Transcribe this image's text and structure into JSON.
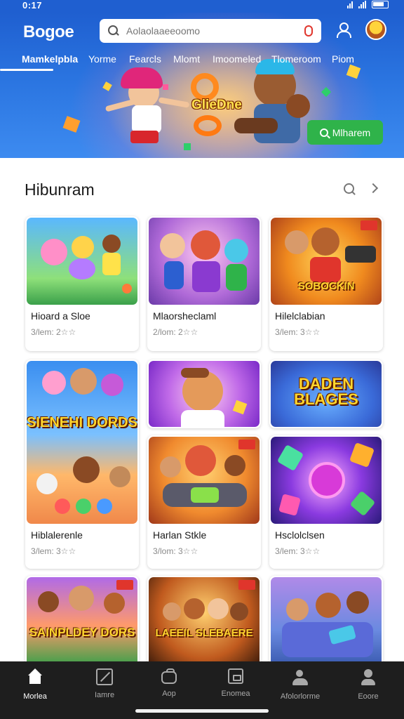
{
  "status_bar": {
    "time": "0:17"
  },
  "header": {
    "logo": "Bogoe",
    "search_placeholder": "Aolaolaaeeoomo",
    "nav_tabs": [
      "Mamkelpbla",
      "Yorme",
      "Fearcls",
      "Mlomt",
      "Imoomeled",
      "Tlomeroom",
      "Piom"
    ],
    "active_tab_index": 0
  },
  "hero": {
    "title": "GlieDne",
    "cta_label": "Mlharem"
  },
  "section": {
    "title": "Hibunram"
  },
  "cards": [
    {
      "title": "Hioard a Sloe",
      "meta": "3/lem: 2☆☆"
    },
    {
      "title": "Mlaorsheclaml",
      "meta": "2/lom: 2☆☆"
    },
    {
      "title": "Hilelclabian",
      "meta": "3/lem: 3☆☆"
    },
    {
      "title": "",
      "meta": "",
      "art_text": "DADEN BLAGES"
    },
    {
      "title": "Hiblalerenle",
      "meta": "3/lem: 3☆☆",
      "art_text": "SIENEHI DORDS"
    },
    {
      "title": "Harlan Stkle",
      "meta": "3/lom: 3☆☆"
    },
    {
      "title": "Hsclolclsen",
      "meta": "3/lem: 3☆☆"
    },
    {
      "title": "",
      "meta": "",
      "art_text": "SAINPLDEY DORS"
    },
    {
      "title": "",
      "meta": "",
      "art_text": "LAEEIL SLEBAERE"
    },
    {
      "title": "",
      "meta": ""
    }
  ],
  "bottom_nav": [
    {
      "label": "Morlea",
      "icon": "home-icon"
    },
    {
      "label": "Iamre",
      "icon": "games-icon"
    },
    {
      "label": "Aop",
      "icon": "apps-icon"
    },
    {
      "label": "Enomea",
      "icon": "movies-icon"
    },
    {
      "label": "Afolorlorme",
      "icon": "activities-icon"
    },
    {
      "label": "Eoore",
      "icon": "account-icon"
    }
  ],
  "colors": {
    "header_blue": "#1f5fd0",
    "cta_green": "#2fb34a",
    "bottom_nav_bg": "#1e1e1e",
    "mic_red": "#e0352c"
  }
}
